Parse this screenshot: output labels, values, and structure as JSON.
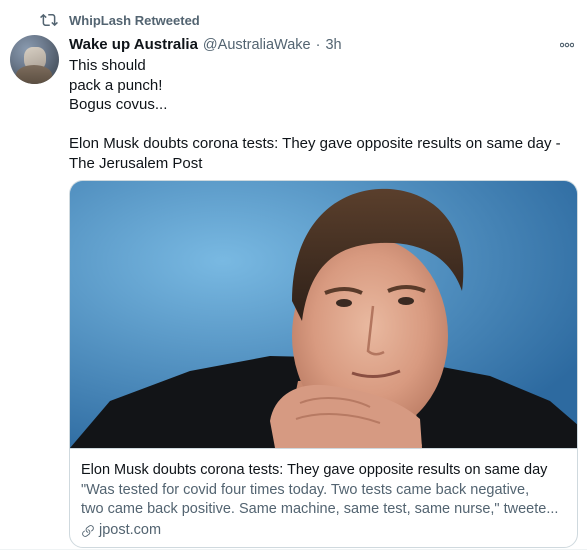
{
  "retweet": {
    "icon": "retweet-icon",
    "label": "WhipLash Retweeted"
  },
  "tweet": {
    "author_name": "Wake up Australia",
    "author_handle": "@AustraliaWake",
    "separator": "·",
    "time": "3h",
    "more_icon": "more-icon",
    "text_lines": [
      "This should",
      "pack a punch!",
      "Bogus covus...",
      "",
      "Elon Musk doubts corona tests: They gave opposite results on same day -",
      "The Jerusalem Post"
    ]
  },
  "card": {
    "image_alt": "man-portrait-photo",
    "title": "Elon Musk doubts corona tests: They gave opposite results on same day",
    "description_lines": [
      "\"Was tested for covid four times today. Two tests came back negative,",
      "two came back positive. Same machine, same test, same nurse,\" tweete..."
    ],
    "domain_icon": "link-icon",
    "domain": "jpost.com"
  },
  "colors": {
    "text_primary": "#0f1419",
    "text_secondary": "#536471",
    "border": "#cfd9de"
  }
}
